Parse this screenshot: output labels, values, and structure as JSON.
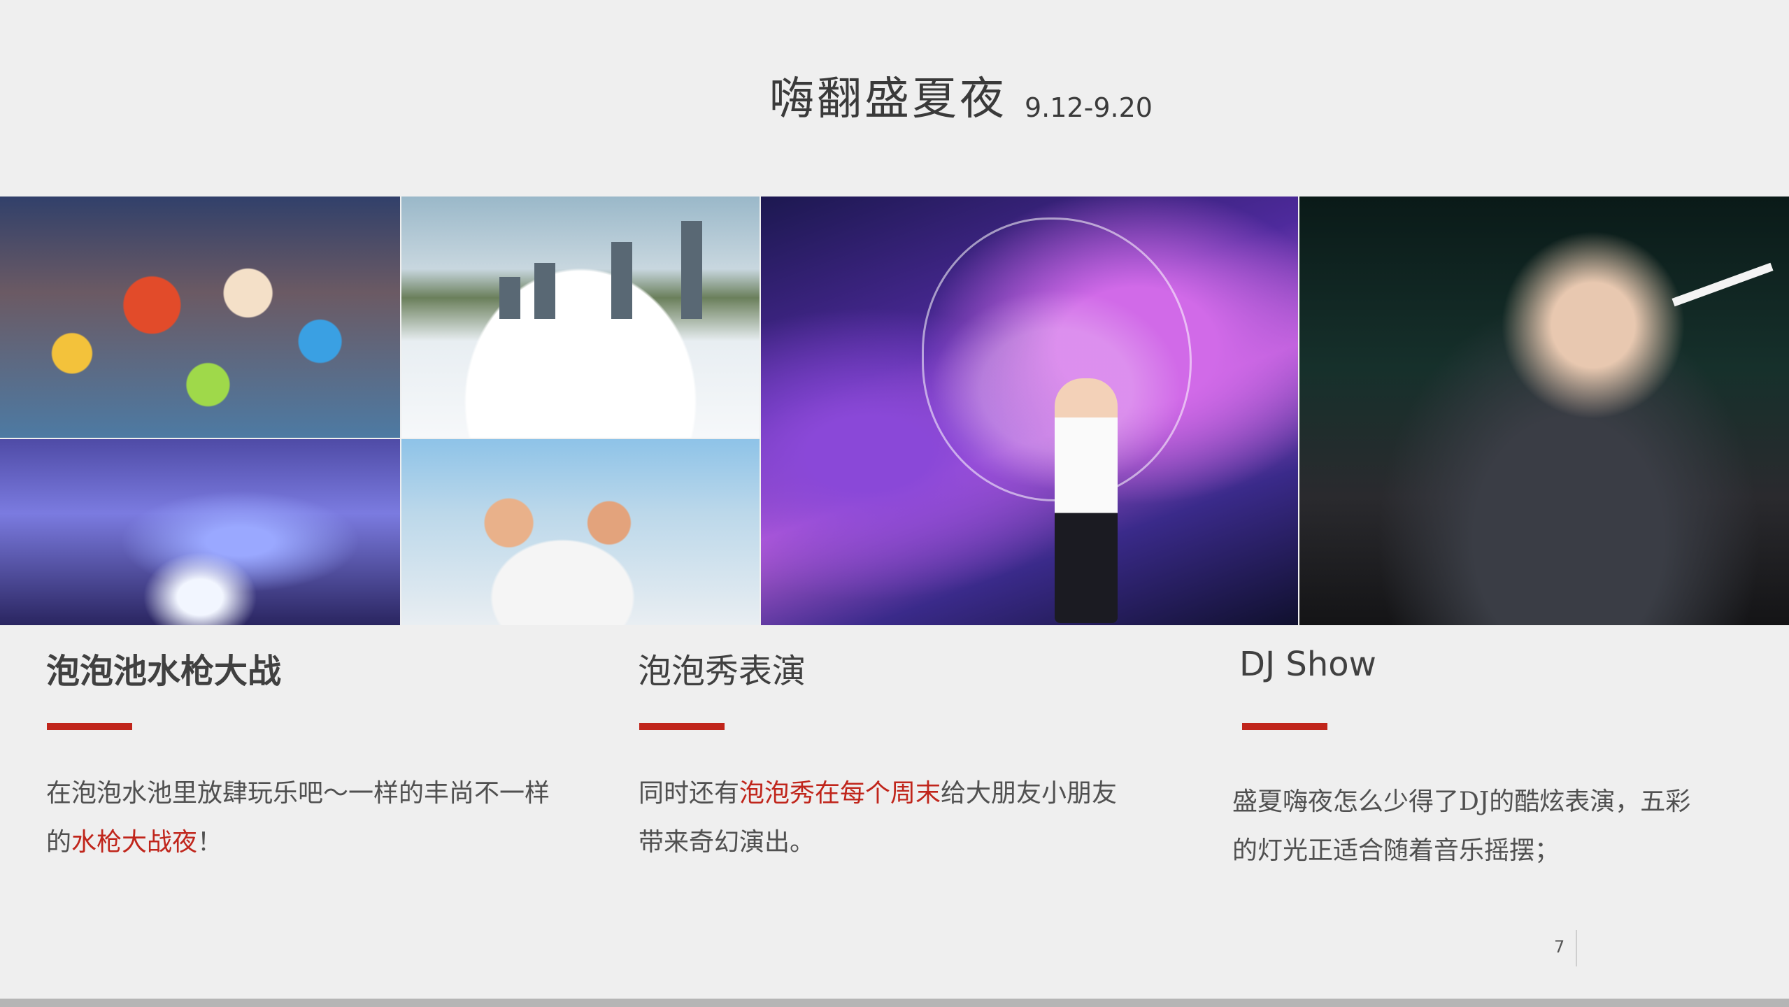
{
  "slide": {
    "title": "嗨翻盛夏夜",
    "date_range": "9.12-9.20",
    "page_number": "7",
    "accent_color": "#c0251b"
  },
  "columns": [
    {
      "heading": "泡泡池水枪大战",
      "text_before": "在泡泡水池里放肆玩乐吧～一样的丰尚不一样的",
      "highlight": "水枪大战夜",
      "text_after": "！"
    },
    {
      "heading": "泡泡秀表演",
      "text_before": "同时还有",
      "highlight": "泡泡秀在每个周末",
      "text_after": "给大朋友小朋友带来奇幻演出。"
    },
    {
      "heading": "DJ Show",
      "text_before": "盛夏嗨夜怎么少得了DJ的酷炫表演，五彩的灯光正适合随着音乐摇摆；",
      "highlight": "",
      "text_after": ""
    }
  ]
}
